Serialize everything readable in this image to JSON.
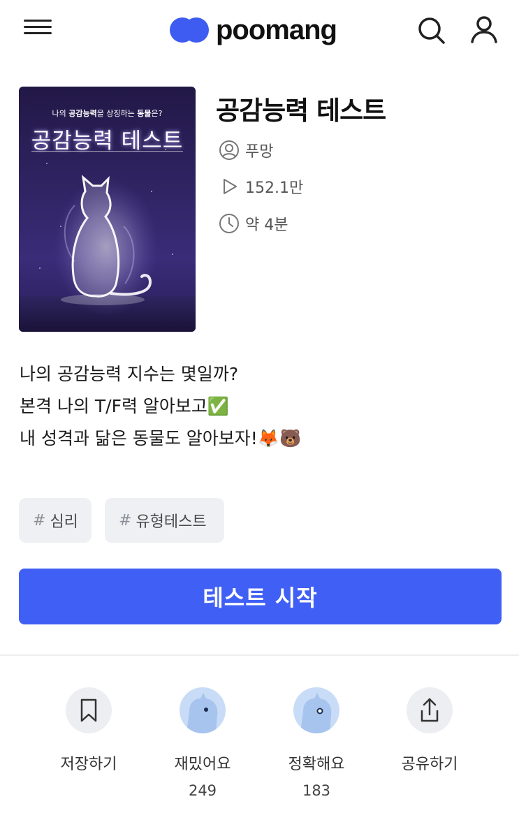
{
  "header": {
    "logo_text": "poomang",
    "icons": [
      "menu-icon",
      "search-icon",
      "user-icon"
    ]
  },
  "thumbnail": {
    "subtitle_pre": "나의 ",
    "subtitle_bold1": "공감능력",
    "subtitle_mid": "을 상징하는 ",
    "subtitle_bold2": "동물",
    "subtitle_post": "은?",
    "title": "공감능력 테스트"
  },
  "test": {
    "title": "공감능력 테스트",
    "author": "푸망",
    "plays": "152.1만",
    "duration": "약 4분"
  },
  "description": {
    "line1": "나의 공감능력 지수는 몇일까?",
    "line2": "본격 나의 T/F력 알아보고✅",
    "line3": "내 성격과 닮은 동물도 알아보자!🦊🐻"
  },
  "tags": [
    {
      "hash": "#",
      "label": "심리"
    },
    {
      "hash": "#",
      "label": "유형테스트"
    }
  ],
  "start_button": "테스트 시작",
  "actions": [
    {
      "label": "저장하기",
      "icon": "bookmark-icon"
    },
    {
      "label": "재밌어요",
      "count": "249",
      "icon": "funny-mascot-icon"
    },
    {
      "label": "정확해요",
      "count": "183",
      "icon": "accurate-mascot-icon"
    },
    {
      "label": "공유하기",
      "icon": "share-icon"
    }
  ],
  "colors": {
    "brand": "#3f5cf2",
    "button": "#4060f5",
    "thumb_bg_top": "#241a4a",
    "thumb_bg_bottom": "#3a2a72"
  }
}
